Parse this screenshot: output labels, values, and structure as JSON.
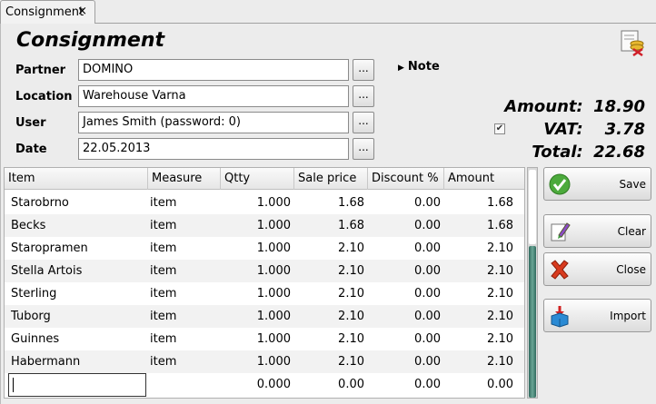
{
  "tab": {
    "label": "Consignment",
    "close": "×"
  },
  "title": "Consignment",
  "form": {
    "partner": {
      "label": "Partner",
      "value": "DOMINO"
    },
    "location": {
      "label": "Location",
      "value": "Warehouse Varna"
    },
    "user": {
      "label": "User",
      "value": "James Smith (password: 0)"
    },
    "date": {
      "label": "Date",
      "value": "22.05.2013"
    },
    "browse_label": "..."
  },
  "note": {
    "label": "Note"
  },
  "totals": {
    "amount": {
      "label": "Amount:",
      "value": "18.90"
    },
    "vat": {
      "label": "VAT:",
      "value": "3.78",
      "checked": true
    },
    "total": {
      "label": "Total:",
      "value": "22.68"
    }
  },
  "grid": {
    "columns": [
      "Item",
      "Measure",
      "Qtty",
      "Sale price",
      "Discount %",
      "Amount"
    ],
    "rows": [
      [
        "Starobrno",
        "item",
        "1.000",
        "1.68",
        "0.00",
        "1.68"
      ],
      [
        "Becks",
        "item",
        "1.000",
        "1.68",
        "0.00",
        "1.68"
      ],
      [
        "Staropramen",
        "item",
        "1.000",
        "2.10",
        "0.00",
        "2.10"
      ],
      [
        "Stella Artois",
        "item",
        "1.000",
        "2.10",
        "0.00",
        "2.10"
      ],
      [
        "Sterling",
        "item",
        "1.000",
        "2.10",
        "0.00",
        "2.10"
      ],
      [
        "Tuborg",
        "item",
        "1.000",
        "2.10",
        "0.00",
        "2.10"
      ],
      [
        "Guinnes",
        "item",
        "1.000",
        "2.10",
        "0.00",
        "2.10"
      ],
      [
        "Habermann",
        "item",
        "1.000",
        "2.10",
        "0.00",
        "2.10"
      ]
    ],
    "new_row": [
      "",
      "",
      "0.000",
      "0.00",
      "0.00",
      "0.00"
    ]
  },
  "buttons": {
    "save": "Save",
    "clear": "Clear",
    "close": "Close",
    "import": "Import"
  },
  "colors": {
    "scroll_thumb": "#4d8a7c",
    "save_icon": "#4caa3c",
    "close_icon": "#d83a1e"
  }
}
